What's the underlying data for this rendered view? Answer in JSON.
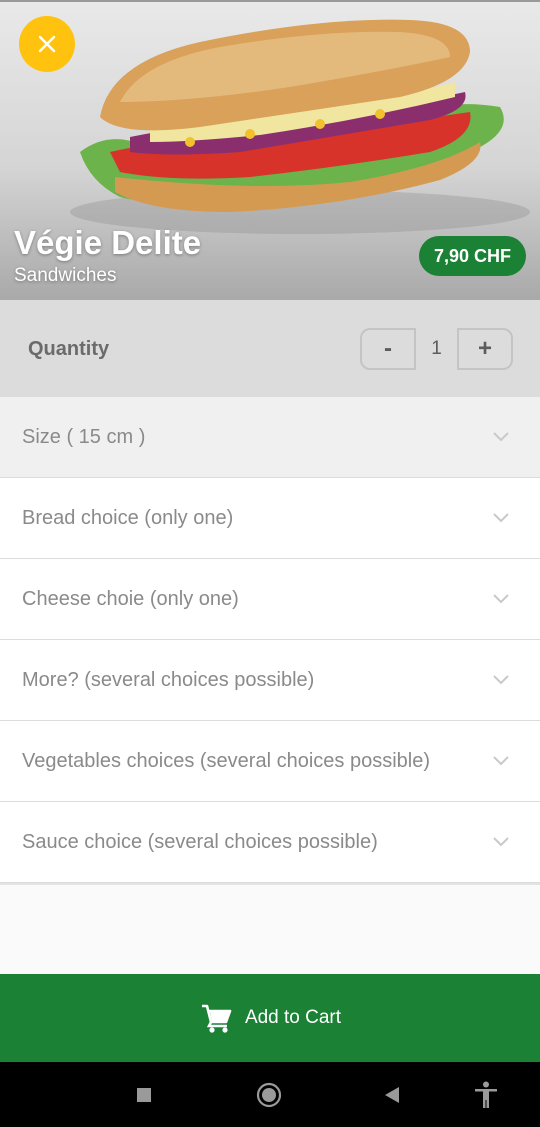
{
  "product": {
    "name": "Végie Delite",
    "category": "Sandwiches",
    "price": "7,90 CHF"
  },
  "quantity": {
    "label": "Quantity",
    "minus": "-",
    "value": "1",
    "plus": "+"
  },
  "options": [
    {
      "label": "Size ( 15 cm )"
    },
    {
      "label": "Bread choice (only one)"
    },
    {
      "label": "Cheese choie (only one)"
    },
    {
      "label": "More? (several choices possible)"
    },
    {
      "label": "Vegetables choices (several choices possible)"
    },
    {
      "label": "Sauce choice (several choices possible)"
    }
  ],
  "cart": {
    "label": "Add to Cart",
    "icon": "cart-icon"
  },
  "colors": {
    "brand_green": "#1a8135",
    "accent_yellow": "#ffc20e"
  }
}
